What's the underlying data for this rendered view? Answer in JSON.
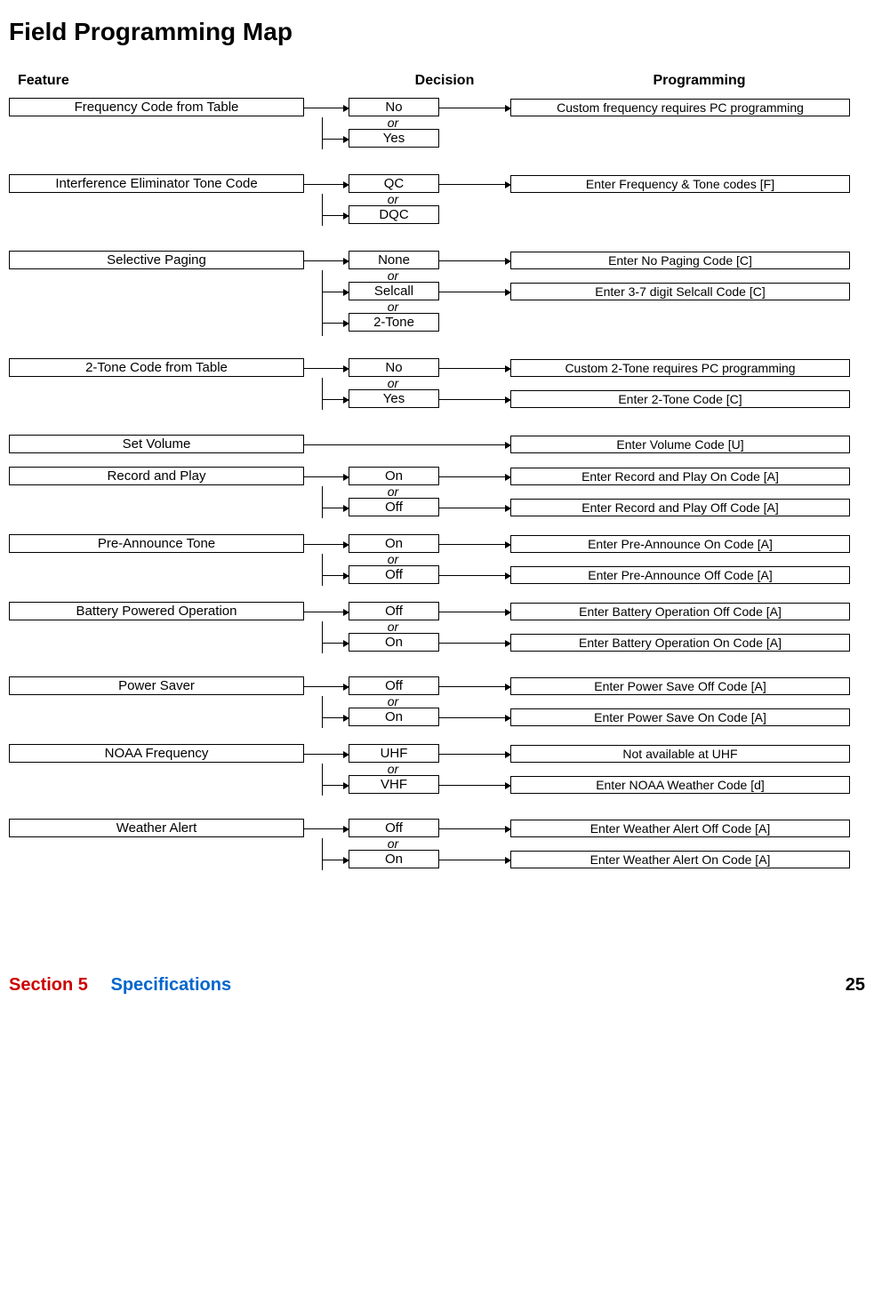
{
  "title": "Field Programming Map",
  "headers": {
    "feature": "Feature",
    "decision": "Decision",
    "programming": "Programming"
  },
  "rows": {
    "r1": {
      "feature": "Frequency Code from Table",
      "d1": "No",
      "p1": "Custom frequency requires PC programming",
      "or": "or",
      "d2": "Yes"
    },
    "r2": {
      "feature": "Interference Eliminator Tone Code",
      "d1": "QC",
      "p1": "Enter Frequency & Tone codes [F]",
      "or": "or",
      "d2": "DQC"
    },
    "r3": {
      "feature": "Selective Paging",
      "d1": "None",
      "p1": "Enter No Paging Code [C]",
      "or1": "or",
      "d2": "Selcall",
      "p2": "Enter 3-7 digit Selcall Code [C]",
      "or2": "or",
      "d3": "2-Tone"
    },
    "r4": {
      "feature": "2-Tone Code from Table",
      "d1": "No",
      "p1": "Custom 2-Tone requires PC programming",
      "or": "or",
      "d2": "Yes",
      "p2": "Enter 2-Tone Code [C]"
    },
    "r5": {
      "feature": "Set Volume",
      "p1": "Enter Volume Code [U]"
    },
    "r6": {
      "feature": "Record and Play",
      "d1": "On",
      "p1": "Enter Record and Play On Code [A]",
      "or": "or",
      "d2": "Off",
      "p2": "Enter Record and Play Off Code [A]"
    },
    "r7": {
      "feature": "Pre-Announce Tone",
      "d1": "On",
      "p1": "Enter Pre-Announce On Code [A]",
      "or": "or",
      "d2": "Off",
      "p2": "Enter Pre-Announce Off Code [A]"
    },
    "r8": {
      "feature": "Battery Powered Operation",
      "d1": "Off",
      "p1": "Enter Battery Operation Off Code [A]",
      "or": "or",
      "d2": "On",
      "p2": "Enter Battery Operation On Code [A]"
    },
    "r9": {
      "feature": "Power Saver",
      "d1": "Off",
      "p1": "Enter Power Save Off Code [A]",
      "or": "or",
      "d2": "On",
      "p2": "Enter Power Save On Code [A]"
    },
    "r10": {
      "feature": "NOAA Frequency",
      "d1": "UHF",
      "p1": "Not available at UHF",
      "or": "or",
      "d2": "VHF",
      "p2": "Enter NOAA Weather Code [d]"
    },
    "r11": {
      "feature": "Weather Alert",
      "d1": "Off",
      "p1": "Enter Weather Alert Off Code [A]",
      "or": "or",
      "d2": "On",
      "p2": "Enter Weather Alert On Code [A]"
    }
  },
  "footer": {
    "section": "Section 5",
    "spec": "Specifications",
    "page": "25"
  }
}
